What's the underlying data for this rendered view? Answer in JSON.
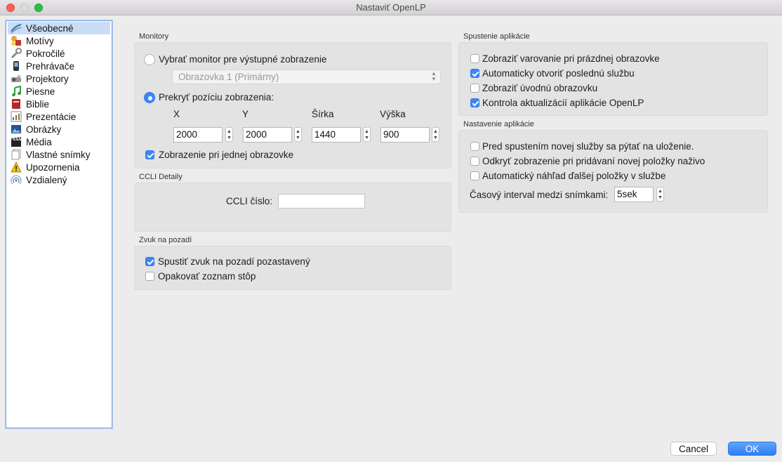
{
  "window": {
    "title": "Nastaviť OpenLP"
  },
  "sidebar": {
    "items": [
      {
        "label": "Všeobecné",
        "icon": "general-settings-icon",
        "selected": true
      },
      {
        "label": "Motívy",
        "icon": "themes-icon"
      },
      {
        "label": "Pokročilé",
        "icon": "advanced-wrench-icon"
      },
      {
        "label": "Prehrávače",
        "icon": "media-player-icon"
      },
      {
        "label": "Projektory",
        "icon": "projector-icon"
      },
      {
        "label": "Piesne",
        "icon": "music-note-icon"
      },
      {
        "label": "Biblie",
        "icon": "bible-icon"
      },
      {
        "label": "Prezentácie",
        "icon": "presentation-chart-icon"
      },
      {
        "label": "Obrázky",
        "icon": "images-icon"
      },
      {
        "label": "Média",
        "icon": "clapperboard-icon"
      },
      {
        "label": "Vlastné snímky",
        "icon": "custom-slides-icon"
      },
      {
        "label": "Upozornenia",
        "icon": "warning-icon"
      },
      {
        "label": "Vzdialený",
        "icon": "remote-signal-icon"
      }
    ]
  },
  "monitors": {
    "title": "Monitory",
    "select_monitor_label": "Vybrať monitor pre výstupné zobrazenie",
    "select_monitor_checked": false,
    "monitor_combo_value": "Obrazovka 1 (Primárny)",
    "override_label": "Prekryť pozíciu zobrazenia:",
    "override_checked": true,
    "x_label": "X",
    "y_label": "Y",
    "width_label": "Šírka",
    "height_label": "Výška",
    "x_value": "2000",
    "y_value": "2000",
    "width_value": "1440",
    "height_value": "900",
    "single_screen_label": "Zobrazenie pri jednej obrazovke",
    "single_screen_checked": true
  },
  "ccli": {
    "title": "CCLI Detaily",
    "number_label": "CCLI číslo:",
    "number_value": ""
  },
  "background_audio": {
    "title": "Zvuk na pozadí",
    "start_paused_label": "Spustiť zvuk na pozadí pozastavený",
    "start_paused_checked": true,
    "repeat_label": "Opakovať zoznam stôp",
    "repeat_checked": false
  },
  "startup": {
    "title": "Spustenie aplikácie",
    "items": [
      {
        "label": "Zobraziť varovanie pri prázdnej obrazovke",
        "checked": false
      },
      {
        "label": "Automaticky otvoriť poslednú službu",
        "checked": true
      },
      {
        "label": "Zobraziť úvodnú obrazovku",
        "checked": false
      },
      {
        "label": "Kontrola aktualizácií aplikácie OpenLP",
        "checked": true
      }
    ]
  },
  "app_settings": {
    "title": "Nastavenie aplikácie",
    "items": [
      {
        "label": "Pred spustením novej služby sa pýtať na uloženie.",
        "checked": false
      },
      {
        "label": "Odkryť zobrazenie pri pridávaní novej položky naživo",
        "checked": false
      },
      {
        "label": "Automatický náhľad ďalšej položky v službe",
        "checked": false
      }
    ],
    "interval_label": "Časový interval medzi snímkami:",
    "interval_value": "5sek"
  },
  "buttons": {
    "cancel": "Cancel",
    "ok": "OK"
  }
}
